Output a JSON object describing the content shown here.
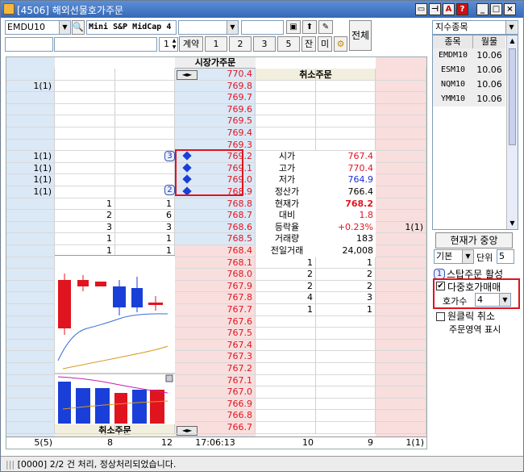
{
  "window": {
    "title": "[4506] 해외선물호가주문"
  },
  "toolbar": {
    "symbol_code": "EMDU10",
    "symbol_name": "Mini S&P MidCap 4",
    "qty_value": "1",
    "contract_label": "계약",
    "qty_buttons": [
      "1",
      "2",
      "3",
      "5",
      "잔",
      "미"
    ],
    "all_label": "전체"
  },
  "headers": {
    "market_order": "시장가주문",
    "cancel_order": "취소주문"
  },
  "ladder": {
    "prices": [
      "770.4",
      "769.8",
      "769.7",
      "769.6",
      "769.5",
      "769.4",
      "769.3",
      "769.2",
      "769.1",
      "769.0",
      "768.9",
      "768.8",
      "768.7",
      "768.6",
      "768.5",
      "768.4",
      "768.1",
      "768.0",
      "767.9",
      "767.8",
      "767.7",
      "767.6",
      "767.5",
      "767.4",
      "767.3",
      "767.2",
      "767.1",
      "767.0",
      "766.9",
      "766.8",
      "766.7"
    ],
    "sell_left": [
      "",
      "1(1)",
      "",
      "",
      "",
      "",
      "",
      "1(1)",
      "1(1)",
      "1(1)",
      "1(1)",
      "",
      "",
      "",
      "",
      "",
      "",
      "",
      "",
      "",
      "",
      "",
      "",
      "",
      "",
      "",
      "",
      "",
      "",
      "",
      ""
    ],
    "sell_qty": [
      "",
      "",
      "",
      "",
      "",
      "",
      "",
      "",
      "",
      "",
      "",
      "1",
      "2",
      "3",
      "1",
      "1",
      "",
      "",
      "",
      "",
      "",
      "",
      "",
      "",
      "",
      "",
      "",
      "",
      "",
      "",
      ""
    ],
    "sell_count": [
      "",
      "",
      "",
      "",
      "",
      "",
      "",
      "",
      "",
      "",
      "",
      "1",
      "6",
      "3",
      "1",
      "1",
      "",
      "",
      "",
      "",
      "",
      "",
      "",
      "",
      "",
      "",
      "",
      "",
      "",
      "",
      ""
    ],
    "buy_count": [
      "",
      "",
      "",
      "",
      "",
      "",
      "",
      "",
      "",
      "",
      "",
      "",
      "",
      "",
      "",
      "",
      "1",
      "2",
      "2",
      "4",
      "1",
      "",
      "",
      "",
      "",
      "",
      "",
      "",
      "",
      "",
      ""
    ],
    "buy_qty": [
      "",
      "",
      "",
      "",
      "",
      "",
      "",
      "",
      "",
      "",
      "",
      "",
      "",
      "",
      "",
      "",
      "1",
      "2",
      "2",
      "3",
      "1",
      "",
      "",
      "",
      "",
      "",
      "",
      "",
      "",
      "",
      ""
    ],
    "buy_right": [
      "",
      "",
      "",
      "",
      "",
      "",
      "",
      "",
      "",
      "",
      "",
      "",
      "",
      "1(1)",
      "",
      "",
      "",
      "",
      "",
      "",
      "",
      "",
      "",
      "",
      "",
      "",
      "",
      "",
      "",
      "",
      ""
    ],
    "badge_top": "3",
    "badge_bottom": "2"
  },
  "info": {
    "labels": [
      "시가",
      "고가",
      "저가",
      "정산가",
      "현재가",
      "대비",
      "등락율",
      "거래량",
      "전일거래"
    ],
    "values": [
      "767.4",
      "770.4",
      "764.9",
      "766.4",
      "768.2",
      "1.8",
      "+0.23%",
      "183",
      "24,008"
    ]
  },
  "footer": {
    "left": "5(5)",
    "l2": "8",
    "l3": "12",
    "time": "17:06:13",
    "r1": "10",
    "r2": "9",
    "r3": "1(1)"
  },
  "right": {
    "index_select": "지수종목",
    "col_code": "종목",
    "col_month": "월물",
    "rows": [
      [
        "EMDM10",
        "10.06"
      ],
      [
        "ESM10",
        "10.06"
      ],
      [
        "NQM10",
        "10.06"
      ],
      [
        "YMM10",
        "10.06"
      ]
    ],
    "center_btn": "현재가 중앙",
    "basis_select": "기본",
    "unit_label": "단위",
    "unit_value": "5",
    "badge": "1",
    "stop_order": "스탑주문 활성",
    "multi_order": "다중호가매매",
    "multi_checked": true,
    "level_label": "호가수",
    "level_value": "4",
    "one_click": "원클릭 취소",
    "cancel_area": "주문영역 표시"
  },
  "status": {
    "message": "[0000] 2/2 건 처리, 정상처리되었습니다."
  },
  "colors": {
    "sell_bg": "#dbe8f6",
    "buy_bg": "#f9dede",
    "highlight": "#e0141e",
    "titlebar": "#3568b8"
  }
}
